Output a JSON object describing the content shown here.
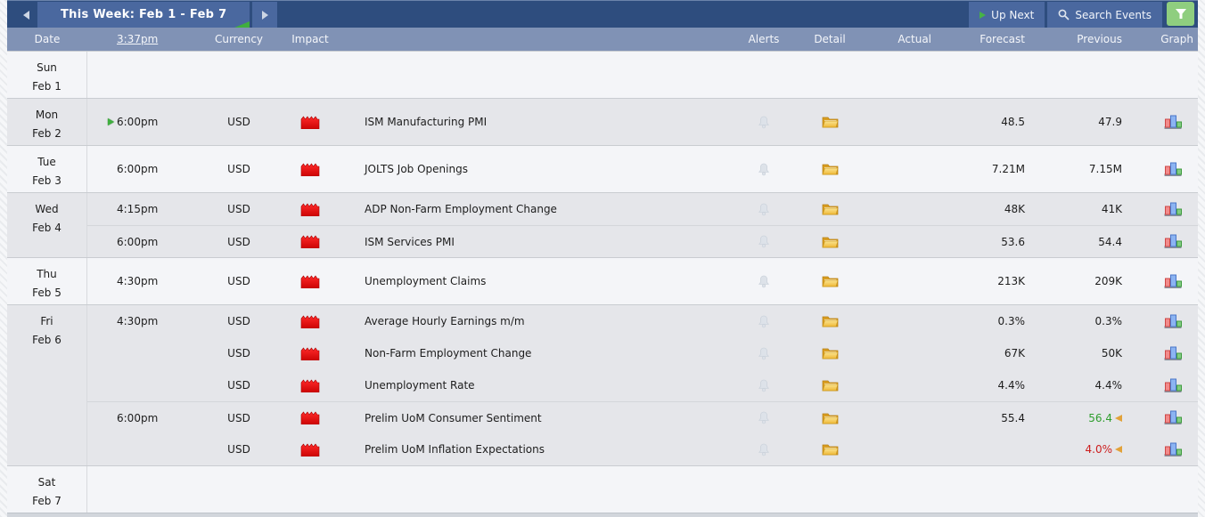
{
  "toolbar": {
    "title": "This Week: Feb 1 - Feb 7",
    "up_next_label": "Up Next",
    "search_label": "Search Events"
  },
  "columns": {
    "date": "Date",
    "time": "3:37pm",
    "currency": "Currency",
    "impact": "Impact",
    "alerts": "Alerts",
    "detail": "Detail",
    "actual": "Actual",
    "forecast": "Forecast",
    "previous": "Previous",
    "graph": "Graph"
  },
  "colors": {
    "topbar_navy": "#2e4d7e",
    "button_blue": "#4a689f",
    "header_blue_gray": "#8092b5",
    "filter_green": "#8fce7f",
    "impact_red": "#ee1010",
    "better_green": "#2f9e2e",
    "worse_red": "#cc1d1d",
    "revised_orange": "#e2a23a"
  },
  "days": [
    {
      "day": "Sun",
      "date": "Feb 1",
      "shade": "light",
      "events": []
    },
    {
      "day": "Mon",
      "date": "Feb 2",
      "shade": "dark",
      "events": [
        {
          "time": "6:00pm",
          "up_next": true,
          "currency": "USD",
          "impact": "high",
          "name": "ISM Manufacturing PMI",
          "actual": "",
          "forecast": "48.5",
          "previous": "47.9"
        }
      ]
    },
    {
      "day": "Tue",
      "date": "Feb 3",
      "shade": "light",
      "events": [
        {
          "time": "6:00pm",
          "currency": "USD",
          "impact": "high",
          "name": "JOLTS Job Openings",
          "actual": "",
          "forecast": "7.21M",
          "previous": "7.15M"
        }
      ]
    },
    {
      "day": "Wed",
      "date": "Feb 4",
      "shade": "dark",
      "events": [
        {
          "time": "4:15pm",
          "currency": "USD",
          "impact": "high",
          "name": "ADP Non-Farm Employment Change",
          "actual": "",
          "forecast": "48K",
          "previous": "41K"
        },
        {
          "time": "6:00pm",
          "new_block": true,
          "currency": "USD",
          "impact": "high",
          "name": "ISM Services PMI",
          "actual": "",
          "forecast": "53.6",
          "previous": "54.4"
        }
      ]
    },
    {
      "day": "Thu",
      "date": "Feb 5",
      "shade": "light",
      "events": [
        {
          "time": "4:30pm",
          "currency": "USD",
          "impact": "high",
          "name": "Unemployment Claims",
          "actual": "",
          "forecast": "213K",
          "previous": "209K"
        }
      ]
    },
    {
      "day": "Fri",
      "date": "Feb 6",
      "shade": "dark",
      "events": [
        {
          "time": "4:30pm",
          "currency": "USD",
          "impact": "high",
          "name": "Average Hourly Earnings m/m",
          "actual": "",
          "forecast": "0.3%",
          "previous": "0.3%"
        },
        {
          "time": "",
          "currency": "USD",
          "impact": "high",
          "name": "Non-Farm Employment Change",
          "actual": "",
          "forecast": "67K",
          "previous": "50K"
        },
        {
          "time": "",
          "currency": "USD",
          "impact": "high",
          "name": "Unemployment Rate",
          "actual": "",
          "forecast": "4.4%",
          "previous": "4.4%"
        },
        {
          "time": "6:00pm",
          "new_block": true,
          "currency": "USD",
          "impact": "high",
          "name": "Prelim UoM Consumer Sentiment",
          "actual": "",
          "forecast": "55.4",
          "previous": "56.4",
          "previous_state": "better",
          "revised": true
        },
        {
          "time": "",
          "currency": "USD",
          "impact": "high",
          "name": "Prelim UoM Inflation Expectations",
          "actual": "",
          "forecast": "",
          "previous": "4.0%",
          "previous_state": "worse",
          "revised": true
        }
      ]
    },
    {
      "day": "Sat",
      "date": "Feb 7",
      "shade": "light",
      "events": []
    }
  ]
}
